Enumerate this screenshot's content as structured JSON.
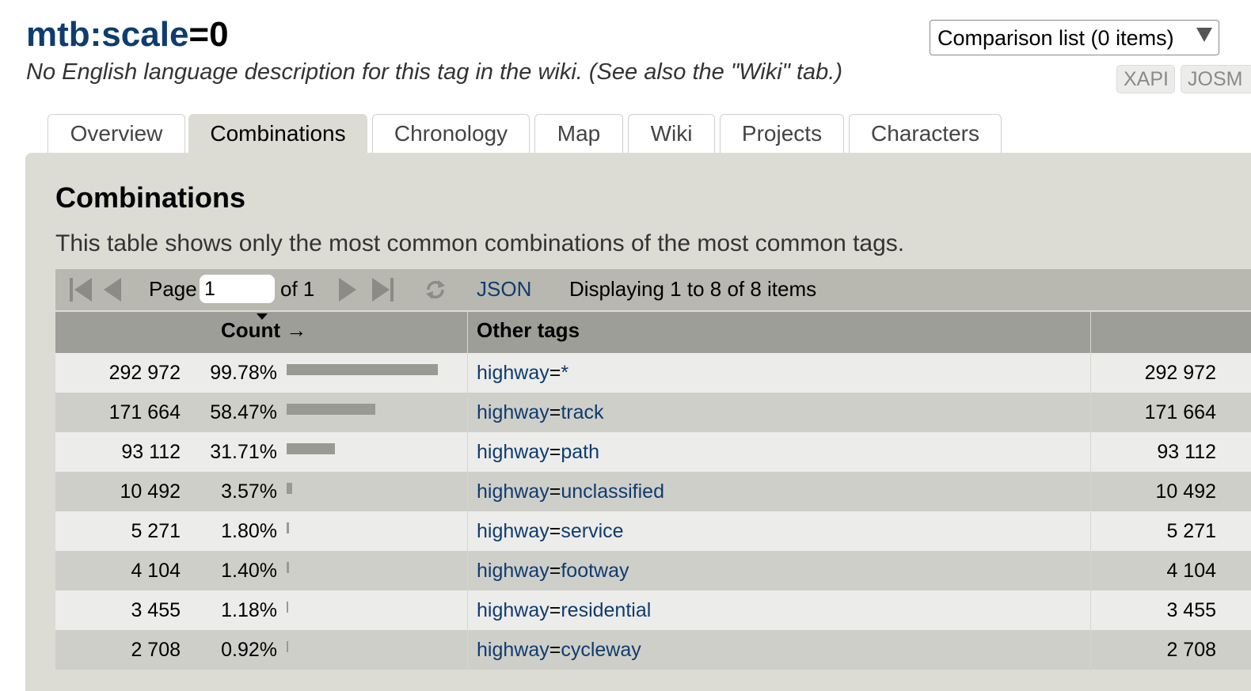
{
  "header": {
    "key": "mtb:scale",
    "eq": "=",
    "value": "0",
    "description": "No English language description for this tag in the wiki. (See also the \"Wiki\" tab.)"
  },
  "comparison": {
    "label": "Comparison list (0 items)"
  },
  "external_buttons": [
    "XAPI",
    "JOSM"
  ],
  "tabs": [
    "Overview",
    "Combinations",
    "Chronology",
    "Map",
    "Wiki",
    "Projects",
    "Characters"
  ],
  "active_tab": "Combinations",
  "section": {
    "title": "Combinations",
    "description": "This table shows only the most common combinations of the most common tags."
  },
  "pager": {
    "page_label": "Page",
    "page_value": "1",
    "of_label": "of 1",
    "json_label": "JSON",
    "display": "Displaying 1 to 8 of 8 items"
  },
  "table": {
    "headers": {
      "count": "Count →",
      "other_tags": "Other tags",
      "last": ""
    },
    "rows": [
      {
        "count": "292 972",
        "pct": "99.78%",
        "fraction": 0.9978,
        "key": "highway",
        "value": "*",
        "total": "292 972"
      },
      {
        "count": "171 664",
        "pct": "58.47%",
        "fraction": 0.5847,
        "key": "highway",
        "value": "track",
        "total": "171 664"
      },
      {
        "count": "93 112",
        "pct": "31.71%",
        "fraction": 0.3171,
        "key": "highway",
        "value": "path",
        "total": "93 112"
      },
      {
        "count": "10 492",
        "pct": "3.57%",
        "fraction": 0.0357,
        "key": "highway",
        "value": "unclassified",
        "total": "10 492"
      },
      {
        "count": "5 271",
        "pct": "1.80%",
        "fraction": 0.018,
        "key": "highway",
        "value": "service",
        "total": "5 271"
      },
      {
        "count": "4 104",
        "pct": "1.40%",
        "fraction": 0.014,
        "key": "highway",
        "value": "footway",
        "total": "4 104"
      },
      {
        "count": "3 455",
        "pct": "1.18%",
        "fraction": 0.0118,
        "key": "highway",
        "value": "residential",
        "total": "3 455"
      },
      {
        "count": "2 708",
        "pct": "0.92%",
        "fraction": 0.0092,
        "key": "highway",
        "value": "cycleway",
        "total": "2 708"
      }
    ]
  },
  "icons": {
    "pager": [
      "first-page-icon",
      "prev-page-icon",
      "next-page-icon",
      "last-page-icon",
      "reload-icon"
    ],
    "dropdown": "chevron-down-icon"
  },
  "colors": {
    "link": "#0f3c6e",
    "panel": "#dcdcd4",
    "pager": "#b8b8b0",
    "header": "#9e9e98",
    "row_light": "#ececea",
    "row_dark": "#cfcfca",
    "bar": "#9a9a94"
  }
}
